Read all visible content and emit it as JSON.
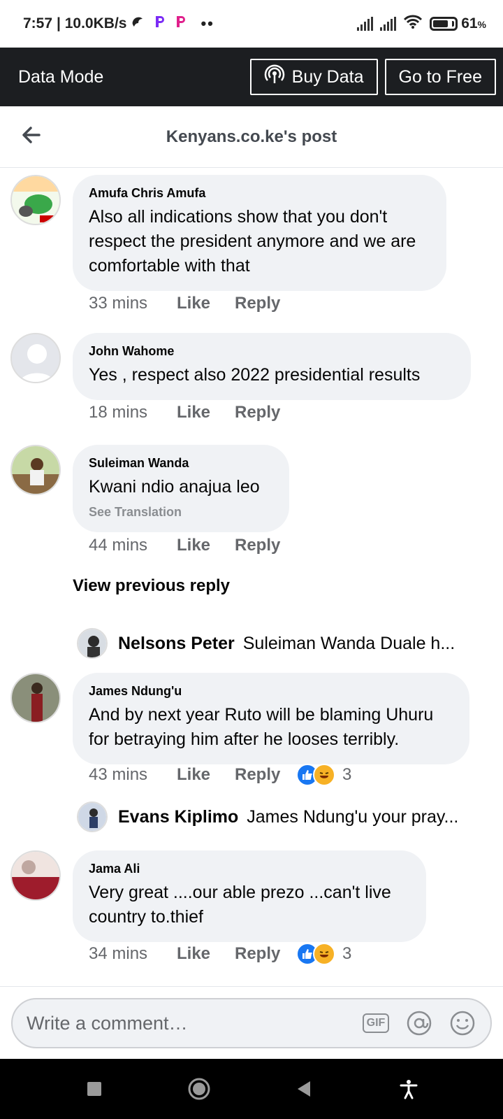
{
  "status": {
    "time": "7:57",
    "speed": "| 10.0KB/s",
    "battery": "61",
    "battery_unit": "%"
  },
  "data_mode": {
    "title": "Data Mode",
    "buy_label": "Buy Data",
    "free_label": "Go to Free"
  },
  "header": {
    "title": "Kenyans.co.ke's post"
  },
  "comments": [
    {
      "author": "Amufa Chris Amufa",
      "text": "Also all indications show that you don't respect the president anymore and we are comfortable with that",
      "time": "33 mins",
      "like": "Like",
      "reply": "Reply"
    },
    {
      "author": "John Wahome",
      "text": "Yes , respect also  2022  presidential results",
      "time": "18 mins",
      "like": "Like",
      "reply": "Reply"
    },
    {
      "author": "Suleiman Wanda",
      "text": "Kwani ndio anajua leo",
      "translation": "See Translation",
      "time": "44 mins",
      "like": "Like",
      "reply": "Reply"
    },
    {
      "author": "James Ndung'u",
      "text": "And by next year Ruto will be blaming Uhuru for betraying him after he looses terribly.",
      "time": "43 mins",
      "like": "Like",
      "reply": "Reply",
      "reactions": "3"
    },
    {
      "author": "Jama Ali",
      "text": "Very great ....our able prezo ...can't live country to.thief",
      "time": "34 mins",
      "like": "Like",
      "reply": "Reply",
      "reactions": "3"
    }
  ],
  "view_previous": "View previous reply",
  "replies": [
    {
      "name": "Nelsons Peter",
      "text": "Suleiman Wanda Duale h..."
    },
    {
      "name": "Evans Kiplimo",
      "text": "James Ndung'u your pray..."
    }
  ],
  "composer": {
    "placeholder": "Write a comment…",
    "gif_label": "GIF"
  }
}
